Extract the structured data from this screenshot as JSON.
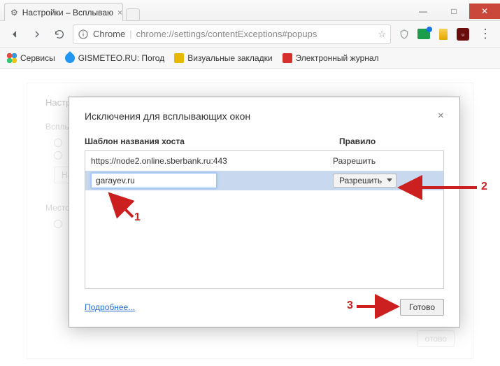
{
  "window": {
    "tab_title": "Настройки – Всплываю",
    "minimize": "—",
    "maximize": "□",
    "close": "✕"
  },
  "omnibox": {
    "label": "Chrome",
    "url": "chrome://settings/contentExceptions#popups"
  },
  "bookmarks": {
    "apps": "Сервисы",
    "gismeteo": "GISMETEO.RU: Погод",
    "visual": "Визуальные закладки",
    "journal": "Электронный журнал"
  },
  "bg_settings": {
    "heading": "Настро",
    "popup_section": "Всплы",
    "loc_section": "Место",
    "exceptions_btn": "На",
    "ready": "отово"
  },
  "modal": {
    "title": "Исключения для всплывающих окон",
    "col_host": "Шаблон названия хоста",
    "col_rule": "Правило",
    "rows": [
      {
        "host": "https://node2.online.sberbank.ru:443",
        "rule": "Разрешить"
      }
    ],
    "input_value": "garayev.ru",
    "select_value": "Разрешить",
    "learn_more": "Подробнее...",
    "done": "Готово"
  },
  "anno": {
    "n1": "1",
    "n2": "2",
    "n3": "3"
  }
}
